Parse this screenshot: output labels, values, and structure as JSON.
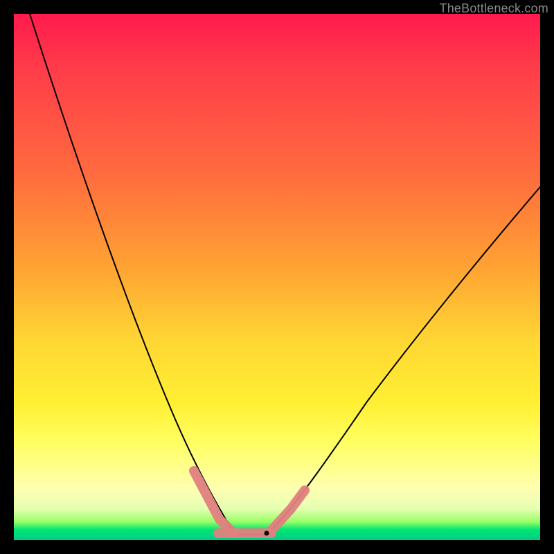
{
  "watermark": "TheBottleneck.com",
  "colors": {
    "frame": "#000000",
    "gradient_top": "#ff1a4d",
    "gradient_mid": "#ffd633",
    "gradient_bottom": "#00cc88",
    "curve": "#000000",
    "marker": "#e08080"
  },
  "chart_data": {
    "type": "line",
    "title": "",
    "xlabel": "",
    "ylabel": "",
    "xlim": [
      0,
      100
    ],
    "ylim": [
      0,
      100
    ],
    "grid": false,
    "legend": false,
    "series": [
      {
        "name": "left-curve",
        "x": [
          3,
          10,
          18,
          24,
          30,
          34,
          37,
          40,
          42
        ],
        "y": [
          100,
          80,
          55,
          38,
          22,
          12,
          6,
          2,
          0
        ]
      },
      {
        "name": "right-curve",
        "x": [
          48,
          52,
          58,
          66,
          76,
          88,
          100
        ],
        "y": [
          0,
          3,
          10,
          22,
          38,
          55,
          68
        ]
      }
    ],
    "flat_segment": {
      "x": [
        42,
        48
      ],
      "y": 0
    },
    "highlighted_marker_segments": [
      {
        "segment": "left-descend",
        "x": [
          34,
          42
        ],
        "y": [
          12,
          0
        ]
      },
      {
        "segment": "bottom-flat",
        "x": [
          38,
          49
        ],
        "y": [
          0,
          0
        ]
      },
      {
        "segment": "right-ascend",
        "x": [
          49,
          55
        ],
        "y": [
          0,
          8
        ]
      }
    ],
    "min_point": {
      "x": 48,
      "y": 0
    },
    "notes": "Values are estimated from pixel positions; axes are unlabeled in the source image so x and y are normalized 0–100 across the plot area. y=0 is the bottom edge, y=100 is the top edge."
  }
}
